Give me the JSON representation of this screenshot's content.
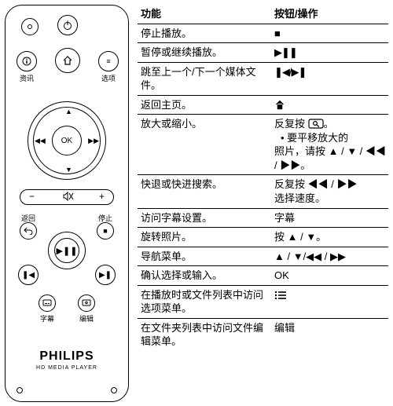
{
  "remote": {
    "brand": "PHILIPS",
    "subbrand": "HD MEDIA PLAYER",
    "labels": {
      "info": "资讯",
      "options": "选项",
      "back": "返回",
      "stop": "停止",
      "subtitle": "字幕",
      "edit": "编辑",
      "ok": "OK"
    },
    "icons": {
      "power": "power-icon",
      "home": "home-icon",
      "mute": "mute-icon",
      "minus": "−",
      "plus": "+",
      "playpause": "play-pause",
      "prev": "prev-track",
      "next": "next-track",
      "rewind": "◀◀",
      "forward": "▶▶",
      "stop_sym": "■"
    }
  },
  "table": {
    "headers": {
      "func": "功能",
      "action": "按钮/操作"
    },
    "rows": [
      {
        "func": "停止播放。",
        "action_type": "icon",
        "action": "■"
      },
      {
        "func": "暂停或继续播放。",
        "action_type": "icon",
        "action": "▶❚❚"
      },
      {
        "func": "跳至上一个/下一个媒体文件。",
        "action_type": "icon",
        "action": "❚◀/▶❚"
      },
      {
        "func": "返回主页。",
        "action_type": "icon",
        "action": "home"
      },
      {
        "func": "放大或缩小。",
        "action_type": "multi",
        "action_main_prefix": "反复按 ",
        "action_main_icon": "zoom",
        "action_main_suffix": "。",
        "sub_bullet_text": "要平移放大的",
        "sub_line2": "照片，请按 ▲ / ▼ / ◀◀ / ▶▶。"
      },
      {
        "func": "快退或快进搜索。",
        "action_type": "multi2",
        "line1": "反复按 ◀◀ / ▶▶",
        "line2": "选择速度。"
      },
      {
        "func": "访问字幕设置。",
        "action_type": "text",
        "action": "字幕"
      },
      {
        "func": "旋转照片。",
        "action_type": "text",
        "action": "按 ▲ / ▼。"
      },
      {
        "func": "导航菜单。",
        "action_type": "text",
        "action": "▲ / ▼/◀◀ / ▶▶"
      },
      {
        "func": "确认选择或输入。",
        "action_type": "text",
        "action": "OK"
      },
      {
        "func": "在播放时或文件列表中访问选项菜单。",
        "action_type": "icon",
        "action": "list"
      },
      {
        "func": "在文件夹列表中访问文件编辑菜单。",
        "action_type": "text",
        "action": "编辑"
      }
    ]
  }
}
